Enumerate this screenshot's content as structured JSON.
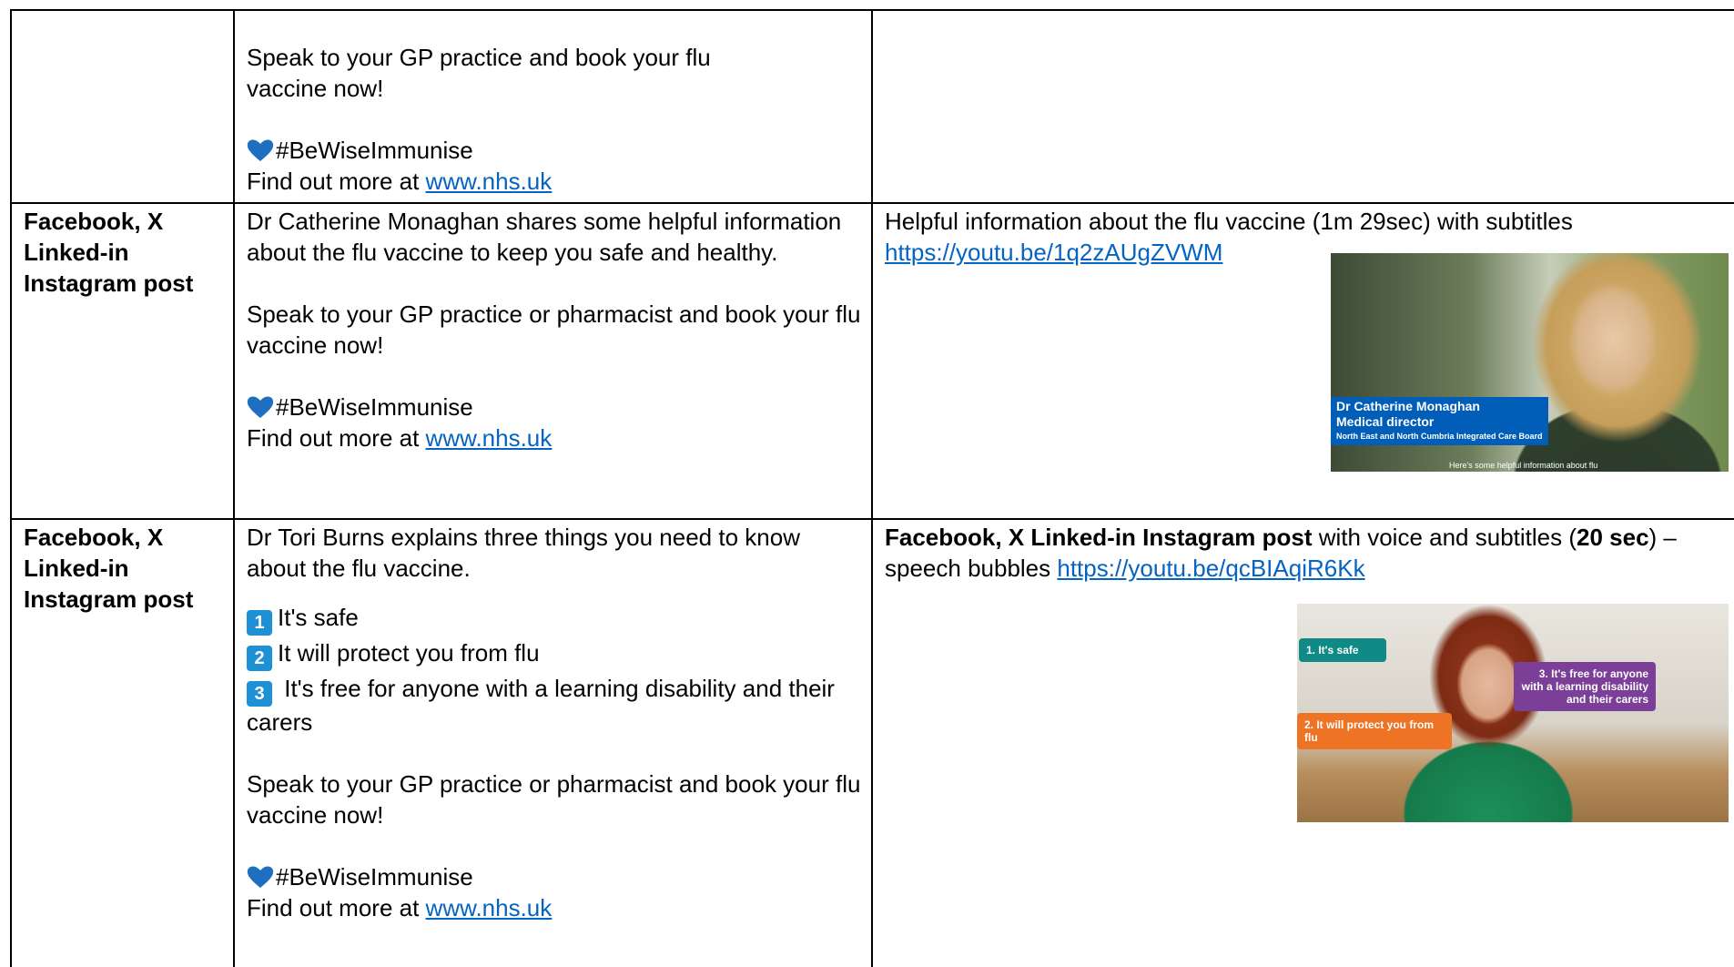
{
  "rows": [
    {
      "platform": [],
      "copy": {
        "line1": "Speak to your GP practice and book your flu vaccine now!",
        "hashtag": "#BeWiseImmunise",
        "find_prefix": "Find out more at ",
        "link": "www.nhs.uk"
      }
    },
    {
      "platform": [
        "Facebook, X",
        "Linked-in",
        "Instagram post"
      ],
      "copy": {
        "intro": "Dr Catherine Monaghan shares some helpful information about the flu vaccine to keep you safe and healthy.",
        "cta": "Speak to your GP practice or pharmacist and book your flu vaccine now!",
        "hashtag": "#BeWiseImmunise",
        "find_prefix": "Find out more at ",
        "link": "www.nhs.uk"
      },
      "asset": {
        "description": "Helpful information about the flu vaccine (1m 29sec) with subtitles",
        "url": "https://youtu.be/1q2zAUgZVWM",
        "thumb": {
          "name": "Dr Catherine Monaghan",
          "role": "Medical director",
          "org": "North East and North Cumbria Integrated Care Board",
          "caption": "Here's some helpful information about flu"
        }
      }
    },
    {
      "platform": [
        "Facebook, X",
        "Linked-in",
        "Instagram post"
      ],
      "copy": {
        "intro": "Dr Tori Burns explains three things you need to know about the flu vaccine.",
        "points": [
          {
            "num": "1",
            "text": "It's safe"
          },
          {
            "num": "2",
            "text": "It will protect you from flu"
          },
          {
            "num": "3",
            "text": " It's free for anyone with a learning disability and their carers"
          }
        ],
        "cta": "Speak to your GP practice or pharmacist and book your flu vaccine now!",
        "hashtag": "#BeWiseImmunise",
        "find_prefix": "Find out more at ",
        "link": "www.nhs.uk"
      },
      "asset": {
        "bold_lead": "Facebook, X Linked-in Instagram post",
        "mid1": " with voice and subtitles (",
        "duration": "20 sec",
        "mid2": ") – speech bubbles ",
        "url": "https://youtu.be/qcBIAqiR6Kk",
        "bubbles": [
          "1. It's safe",
          "2. It will protect you from flu",
          "3. It's free for anyone with a learning disability and their carers"
        ]
      }
    }
  ],
  "colors": {
    "link": "#0563c1",
    "heart": "#1f6fc0",
    "nhs_blue": "#005eb8"
  }
}
